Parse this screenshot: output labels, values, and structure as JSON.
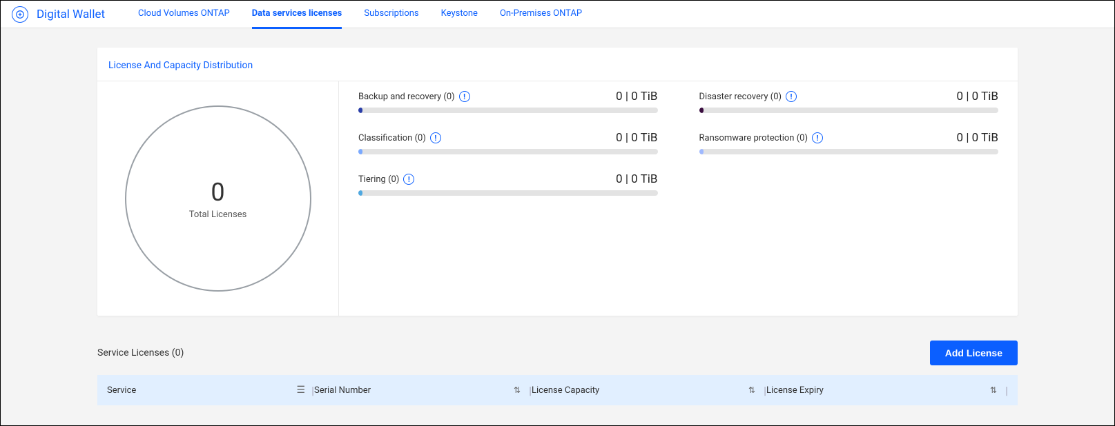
{
  "app": {
    "icon_glyph": "⟳",
    "title": "Digital Wallet"
  },
  "tabs": [
    {
      "label": "Cloud Volumes ONTAP",
      "active": false
    },
    {
      "label": "Data services licenses",
      "active": true
    },
    {
      "label": "Subscriptions",
      "active": false
    },
    {
      "label": "Keystone",
      "active": false
    },
    {
      "label": "On-Premises ONTAP",
      "active": false
    }
  ],
  "distribution": {
    "title": "License And Capacity Distribution",
    "total_value": "0",
    "total_label": "Total Licenses",
    "metrics": [
      {
        "label": "Backup and recovery (0)",
        "value": "0 | 0 TiB",
        "color": "#2a3ea8"
      },
      {
        "label": "Disaster recovery (0)",
        "value": "0 | 0 TiB",
        "color": "#3a0d3f"
      },
      {
        "label": "Classification (0)",
        "value": "0 | 0 TiB",
        "color": "#7aa9ff"
      },
      {
        "label": "Ransomware protection (0)",
        "value": "0 | 0 TiB",
        "color": "#9fb9ff"
      },
      {
        "label": "Tiering (0)",
        "value": "0 | 0 TiB",
        "color": "#4fa8e0"
      }
    ]
  },
  "licenses": {
    "title": "Service Licenses (0)",
    "add_button": "Add License",
    "columns": [
      "Service",
      "Serial Number",
      "License Capacity",
      "License Expiry"
    ]
  },
  "chart_data": {
    "type": "pie",
    "title": "Total Licenses",
    "categories": [
      "Backup and recovery",
      "Disaster recovery",
      "Classification",
      "Ransomware protection",
      "Tiering"
    ],
    "values": [
      0,
      0,
      0,
      0,
      0
    ],
    "total": 0,
    "unit": "TiB"
  }
}
